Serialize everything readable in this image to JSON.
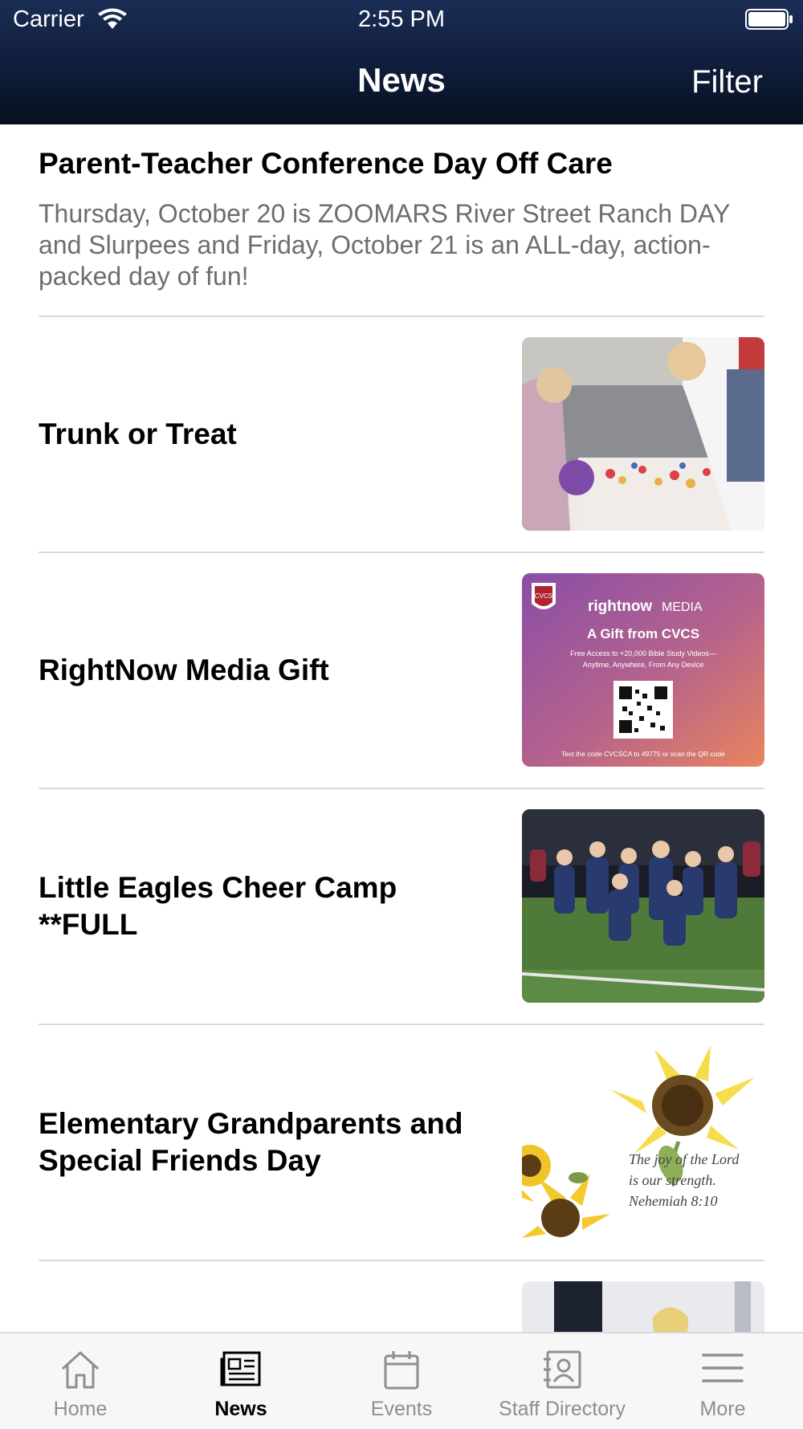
{
  "status_bar": {
    "carrier": "Carrier",
    "time": "2:55 PM"
  },
  "nav": {
    "title": "News",
    "filter_label": "Filter"
  },
  "featured": {
    "title": "Parent-Teacher Conference Day Off Care",
    "summary": "Thursday, October 20 is ZOOMARS River Street Ranch DAY and Slurpees and Friday, October 21 is an ALL-day, action-packed day of fun!"
  },
  "articles": [
    {
      "title": "Trunk or Treat",
      "image": "photo-halloween-candy-table"
    },
    {
      "title": "RightNow Media Gift",
      "image": "rightnow-media-card",
      "card": {
        "badge": "CVCS",
        "brand_bold": "rightnow",
        "brand_light": "MEDIA",
        "headline": "A Gift from CVCS",
        "line1": "Free Access to +20,000 Bible Study Videos—",
        "line2": "Anytime, Anywhere, From Any Device",
        "footer": "Text the code CVCSCA to 49775 or scan the QR code"
      }
    },
    {
      "title": "Little Eagles Cheer Camp **FULL",
      "image": "photo-cheer-camp-field"
    },
    {
      "title": "Elementary Grandparents and Special Friends Day",
      "image": "sunflower-verse-card",
      "card": {
        "verse1": "The joy of the Lord",
        "verse2": "is our strength.",
        "verse3": "Nehemiah 8:10"
      }
    },
    {
      "title": "",
      "image": "photo-partial"
    }
  ],
  "tabs": [
    {
      "label": "Home",
      "icon": "home-icon",
      "active": false
    },
    {
      "label": "News",
      "icon": "newspaper-icon",
      "active": true
    },
    {
      "label": "Events",
      "icon": "calendar-icon",
      "active": false
    },
    {
      "label": "Staff Directory",
      "icon": "contact-book-icon",
      "active": false
    },
    {
      "label": "More",
      "icon": "menu-icon",
      "active": false
    }
  ],
  "colors": {
    "header_dark": "#06101f",
    "header_light": "#1b2d55",
    "summary_gray": "#6d6d72",
    "tab_inactive": "#8e8e93",
    "tab_active": "#000000"
  }
}
